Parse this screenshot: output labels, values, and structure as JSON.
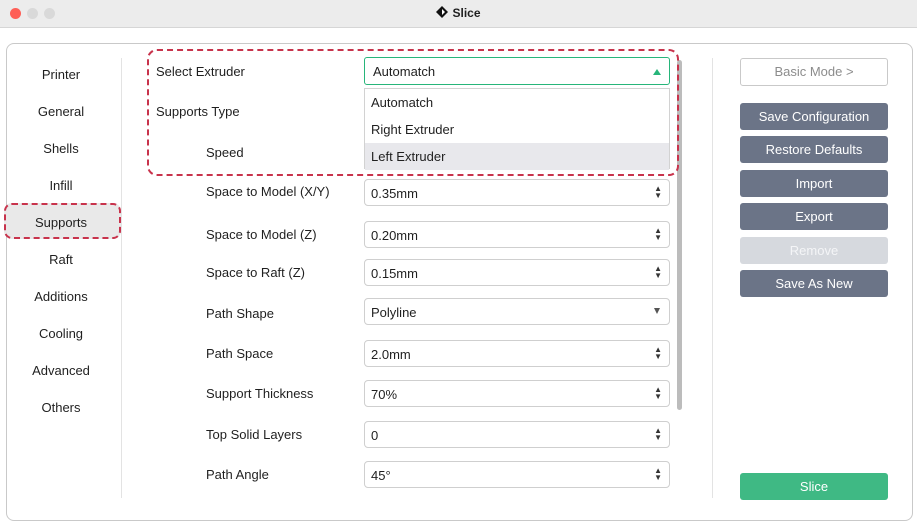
{
  "window": {
    "title": "Slice"
  },
  "sidebar": {
    "items": [
      "Printer",
      "General",
      "Shells",
      "Infill",
      "Supports",
      "Raft",
      "Additions",
      "Cooling",
      "Advanced",
      "Others"
    ],
    "selected": "Supports"
  },
  "settings": {
    "select_extruder": {
      "label": "Select Extruder",
      "value": "Automatch",
      "options": [
        "Automatch",
        "Right Extruder",
        "Left Extruder"
      ],
      "highlighted_option": "Left Extruder"
    },
    "supports_type_label": "Supports Type",
    "speed_label": "Speed",
    "rows": [
      {
        "label": "Space to Model (X/Y)",
        "value": "0.35mm",
        "control": "spinbox"
      },
      {
        "label": "Space to Model (Z)",
        "value": "0.20mm",
        "control": "spinbox"
      },
      {
        "label": "Space to Raft (Z)",
        "value": "0.15mm",
        "control": "spinbox"
      },
      {
        "label": "Path Shape",
        "value": "Polyline",
        "control": "dropdown"
      },
      {
        "label": "Path Space",
        "value": "2.0mm",
        "control": "spinbox"
      },
      {
        "label": "Support Thickness",
        "value": "70%",
        "control": "spinbox"
      },
      {
        "label": "Top Solid Layers",
        "value": "0",
        "control": "spinbox"
      },
      {
        "label": "Path Angle",
        "value": "45°",
        "control": "spinbox"
      }
    ]
  },
  "actions": {
    "basic_mode": "Basic Mode >",
    "save_configuration": "Save Configuration",
    "restore_defaults": "Restore Defaults",
    "import": "Import",
    "export": "Export",
    "remove": "Remove",
    "save_as_new": "Save As New",
    "slice": "Slice"
  },
  "colors": {
    "accent_green": "#3fb984",
    "button_dark": "#6b7487",
    "highlight_dashed": "#c8334c"
  },
  "icons": {
    "app": "slice-app-icon"
  }
}
